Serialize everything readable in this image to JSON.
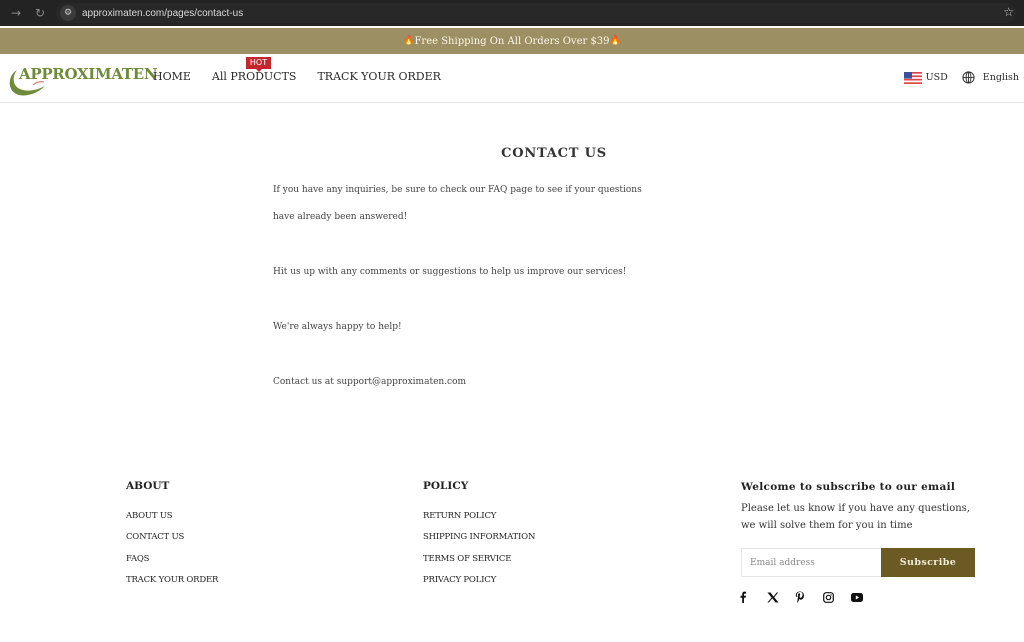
{
  "browser": {
    "url": "approximaten.com/pages/contact-us",
    "forward_icon": "arrow-right-icon",
    "reload_icon": "reload-icon",
    "site_settings_icon": "tune-icon",
    "bookmark_icon": "star-icon"
  },
  "announcement": {
    "text": "Free Shipping On All Orders Over $39",
    "icon": "fire-emoji"
  },
  "header": {
    "logo_text": "APPROXIMATEN",
    "menu": [
      {
        "label": "HOME"
      },
      {
        "label": "All PRODUCTS",
        "badge": "HOT"
      },
      {
        "label": "TRACK YOUR ORDER"
      }
    ],
    "currency": "USD",
    "language": "English"
  },
  "main": {
    "title": "CONTACT US",
    "paragraphs": [
      "If you have any inquiries, be sure to check our FAQ page to see if your questions",
      "have already been answered!",
      "Hit us up with any comments or suggestions to help us improve our services!",
      "We're always happy to help!",
      "Contact us at support@approximaten.com"
    ]
  },
  "footer": {
    "about": {
      "heading": "ABOUT",
      "links": [
        "ABOUT US",
        "CONTACT US",
        "FAQS",
        "TRACK YOUR ORDER"
      ]
    },
    "policy": {
      "heading": "POLICY",
      "links": [
        "RETURN POLICY",
        "SHIPPING INFORMATION",
        "TERMS OF SERVICE",
        "PRIVACY POLICY"
      ]
    },
    "subscribe": {
      "heading": "Welcome to subscribe to our email",
      "text_line1": "Please let us know if you have any questions,",
      "text_line2": "we will solve them for you in time",
      "email_placeholder": "Email address",
      "email_value": "",
      "button_label": "Subscribe"
    },
    "social": [
      "facebook",
      "x",
      "pinterest",
      "instagram",
      "youtube"
    ]
  },
  "colors": {
    "announcement_bg": "#9c8f63",
    "subscribe_btn": "#6b5a24",
    "hot_badge": "#c1272d",
    "logo_green": "#6e8a3a"
  }
}
